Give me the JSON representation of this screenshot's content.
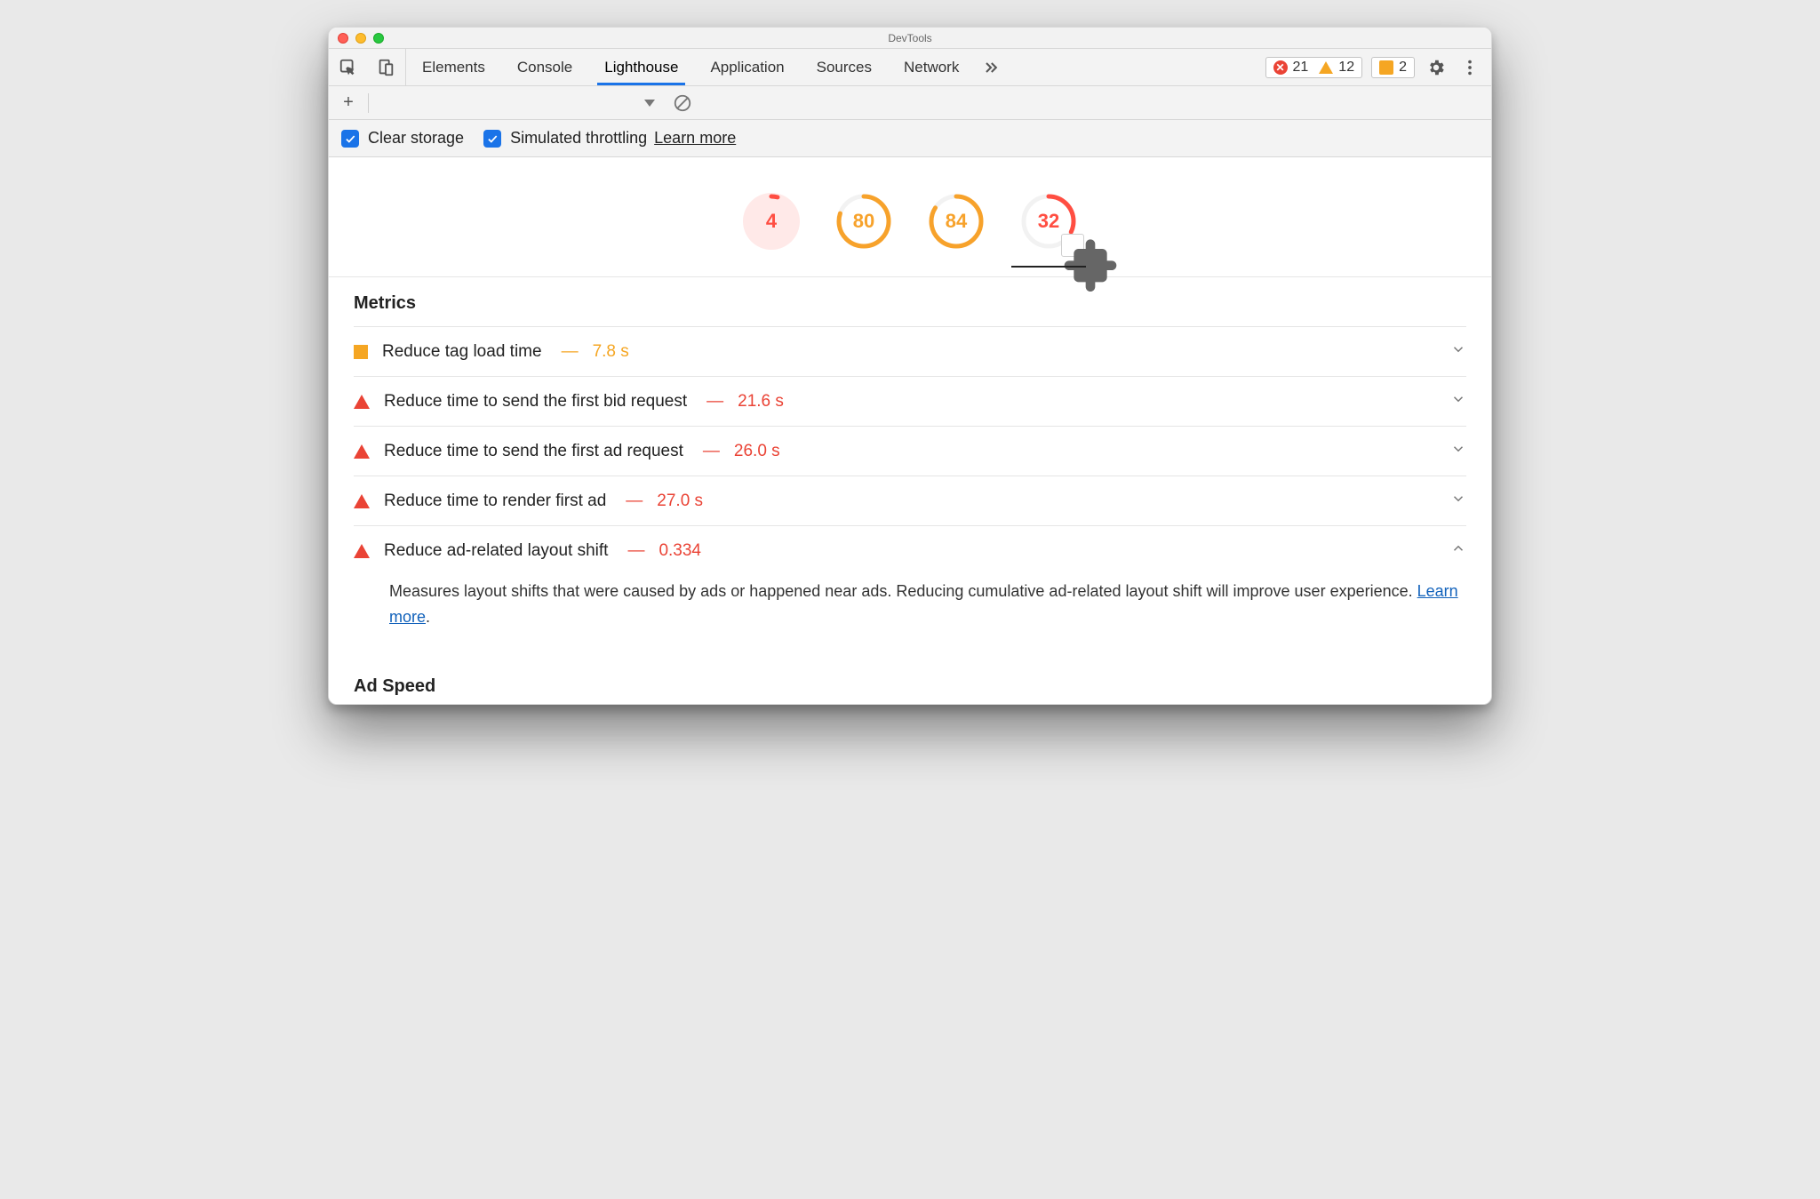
{
  "window": {
    "title": "DevTools"
  },
  "tabs": {
    "items": [
      "Elements",
      "Console",
      "Lighthouse",
      "Application",
      "Sources",
      "Network"
    ],
    "active": "Lighthouse"
  },
  "counters": {
    "errors": "21",
    "warnings": "12",
    "issues": "2"
  },
  "options": {
    "clear_storage_label": "Clear storage",
    "simulated_throttling_label": "Simulated throttling",
    "learn_more": "Learn more"
  },
  "scores": [
    {
      "value": "4",
      "color": "fail",
      "pct": 4
    },
    {
      "value": "80",
      "color": "avg",
      "pct": 80
    },
    {
      "value": "84",
      "color": "avg",
      "pct": 84
    },
    {
      "value": "32",
      "color": "poor",
      "pct": 32,
      "extension": true,
      "selected": true
    }
  ],
  "metrics_title": "Metrics",
  "audits": [
    {
      "icon": "square",
      "title": "Reduce tag load time",
      "value": "7.8 s",
      "valueClass": "orange"
    },
    {
      "icon": "triangle",
      "title": "Reduce time to send the first bid request",
      "value": "21.6 s"
    },
    {
      "icon": "triangle",
      "title": "Reduce time to send the first ad request",
      "value": "26.0 s"
    },
    {
      "icon": "triangle",
      "title": "Reduce time to render first ad",
      "value": "27.0 s"
    },
    {
      "icon": "triangle",
      "title": "Reduce ad-related layout shift",
      "value": "0.334",
      "expanded": true,
      "description": "Measures layout shifts that were caused by ads or happened near ads. Reducing cumulative ad-related layout shift will improve user experience. ",
      "desc_link": "Learn more"
    }
  ],
  "ad_speed_title": "Ad Speed"
}
